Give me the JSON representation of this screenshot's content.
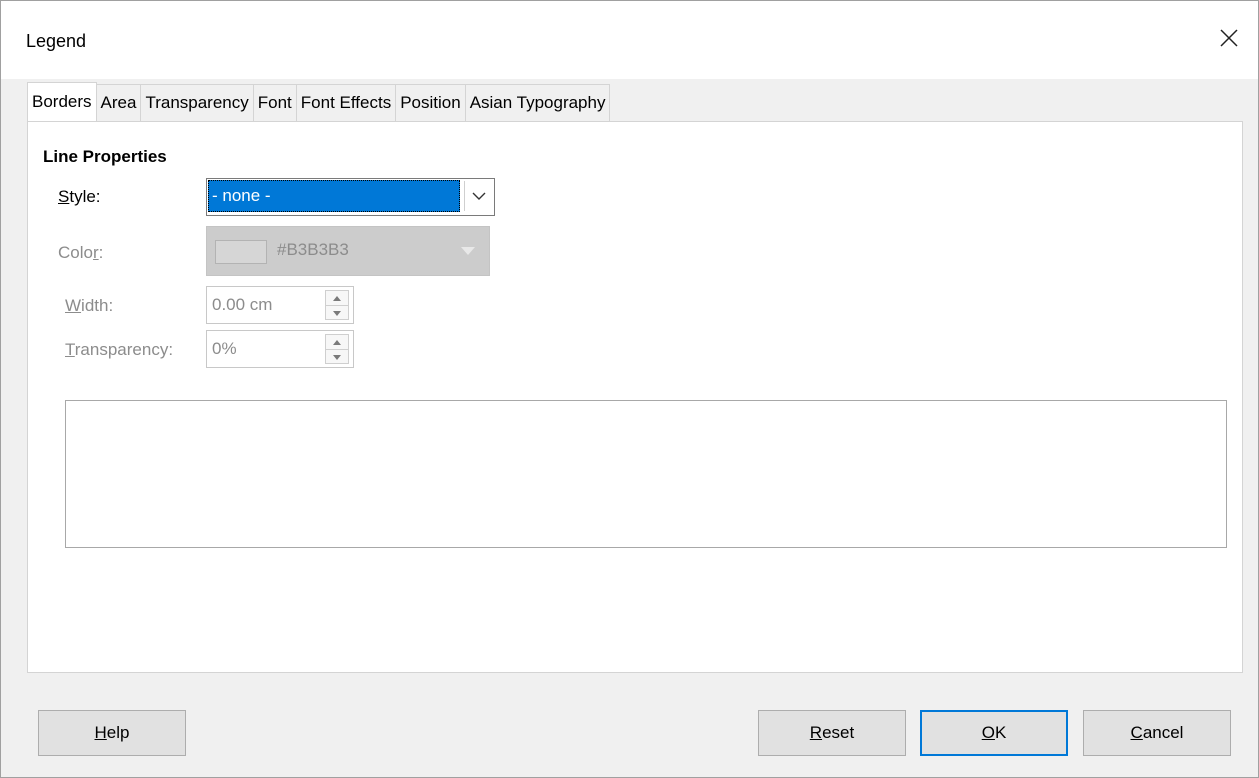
{
  "dialog": {
    "title": "Legend"
  },
  "tabs": [
    {
      "label": "Borders",
      "active": true
    },
    {
      "label": "Area"
    },
    {
      "label": "Transparency"
    },
    {
      "label": "Font"
    },
    {
      "label": "Font Effects"
    },
    {
      "label": "Position"
    },
    {
      "label": "Asian Typography"
    }
  ],
  "line_properties": {
    "section_title": "Line Properties",
    "style": {
      "label_mnemonic": "S",
      "label_rest": "tyle:",
      "value": "- none -"
    },
    "color": {
      "label_pre": "Colo",
      "label_mnemonic": "r",
      "label_post": ":",
      "value": "#B3B3B3",
      "swatch_color": "#B3B3B3"
    },
    "width": {
      "label_mnemonic": "W",
      "label_rest": "idth:",
      "value": "0.00 cm"
    },
    "transparency": {
      "label_mnemonic": "T",
      "label_rest": "ransparency:",
      "value": "0%"
    }
  },
  "buttons": {
    "help": {
      "mnemonic": "H",
      "rest": "elp"
    },
    "reset": {
      "mnemonic": "R",
      "rest": "eset"
    },
    "ok": {
      "mnemonic": "O",
      "rest": "K"
    },
    "cancel": {
      "mnemonic": "C",
      "rest": "ancel"
    }
  },
  "colors": {
    "accent": "#0078d7",
    "disabled_text": "#8c8c8c"
  },
  "icons": {
    "close": "close-icon",
    "dropdown": "chevron-down-icon",
    "spin_up": "spin-up-icon",
    "spin_down": "spin-down-icon"
  }
}
